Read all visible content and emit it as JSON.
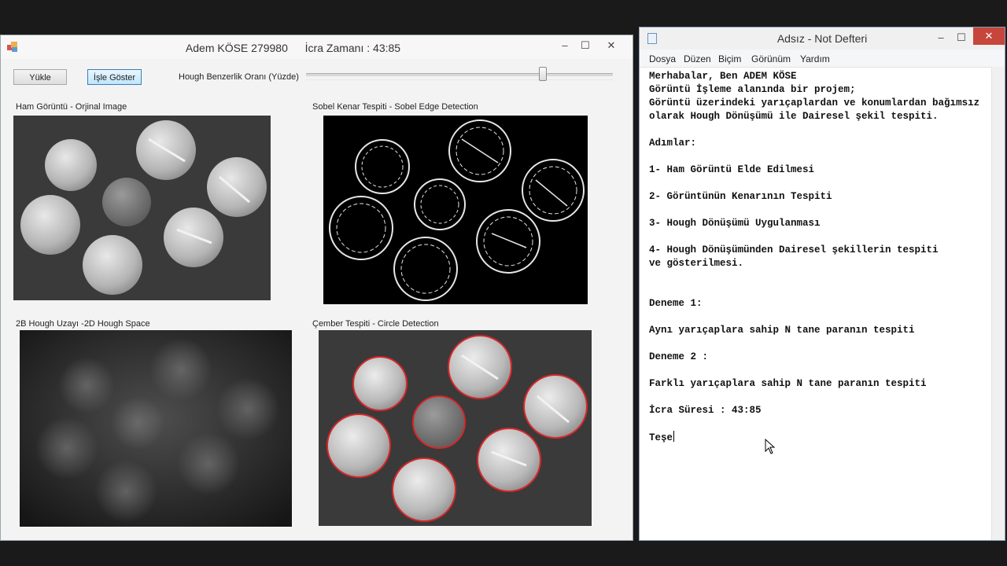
{
  "app": {
    "title": "Adem KÖSE 279980",
    "exec_time_label": "İcra Zamanı : 43:85",
    "controls": {
      "minimize": "–",
      "maximize": "☐",
      "close": "✕"
    },
    "buttons": {
      "load": "Yükle",
      "process": "İşle Göster"
    },
    "slider_label": "Hough Benzerlik Oranı (Yüzde)",
    "slider_value_fraction": 0.78,
    "panels": {
      "raw": "Ham Görüntü - Orjinal Image",
      "sobel": "Sobel Kenar Tespiti - Sobel Edge Detection",
      "hough": "2B Hough Uzayı -2D Hough Space",
      "circle": "Çember Tespiti - Circle Detection"
    },
    "colors": {
      "detection_circle": "#d8262a"
    }
  },
  "notepad": {
    "title": "Adsız - Not Defteri",
    "menu": [
      "Dosya",
      "Düzen",
      "Biçim",
      "Görünüm",
      "Yardım"
    ],
    "lines": [
      "Merhabalar, Ben ADEM KÖSE",
      "Görüntü İşleme alanında bir projem;",
      "Görüntü üzerindeki yarıçaplardan ve konumlardan bağımsız",
      "olarak Hough Dönüşümü ile Dairesel şekil tespiti.",
      "",
      "Adımlar:",
      "",
      "1- Ham Görüntü Elde Edilmesi",
      "",
      "2- Görüntünün Kenarının Tespiti",
      "",
      "3- Hough Dönüşümü Uygulanması",
      "",
      "4- Hough Dönüşümünden Dairesel şekillerin tespiti",
      "ve gösterilmesi.",
      "",
      "",
      "Deneme 1:",
      "",
      "Aynı yarıçaplara sahip N tane paranın tespiti",
      "",
      "Deneme 2 :",
      "",
      "Farklı yarıçaplara sahip N tane paranın tespiti",
      "",
      "İcra Süresi : 43:85",
      "",
      "Teşe"
    ]
  }
}
